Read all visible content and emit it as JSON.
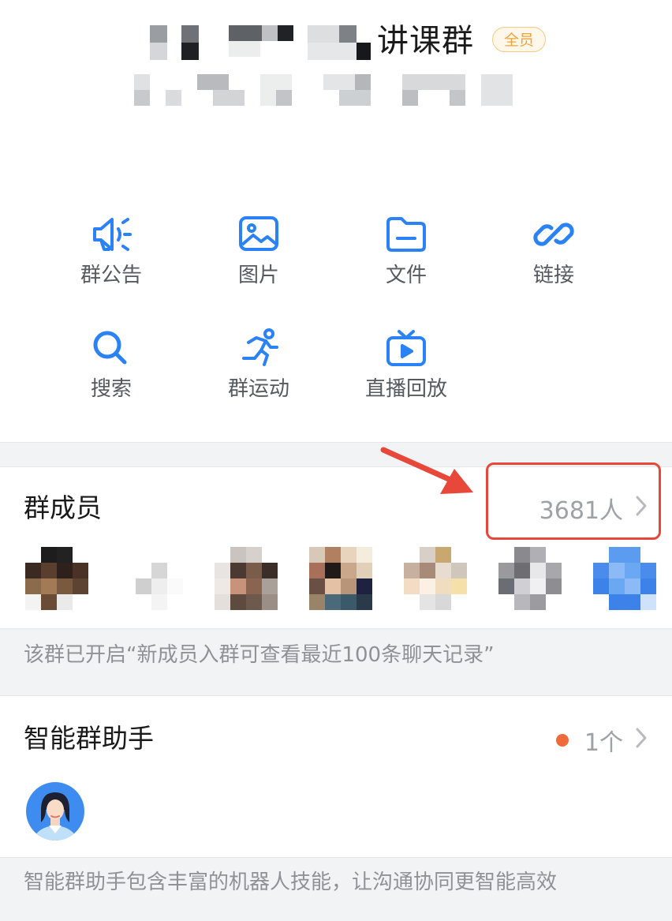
{
  "header": {
    "group_name_visible": "讲课群",
    "badge": "全员"
  },
  "features": [
    {
      "label": "群公告",
      "icon": "megaphone-icon"
    },
    {
      "label": "图片",
      "icon": "image-icon"
    },
    {
      "label": "文件",
      "icon": "folder-icon"
    },
    {
      "label": "链接",
      "icon": "link-icon"
    },
    {
      "label": "搜索",
      "icon": "search-icon"
    },
    {
      "label": "群运动",
      "icon": "running-icon"
    },
    {
      "label": "直播回放",
      "icon": "tv-play-icon"
    }
  ],
  "members": {
    "title": "群成员",
    "count": "3681人",
    "note": "该群已开启“新成员入群可查看最近100条聊天记录”"
  },
  "assistant": {
    "title": "智能群助手",
    "count": "1个",
    "note": "智能群助手包含丰富的机器人技能，让沟通协同更智能高效"
  },
  "colors": {
    "accent": "#2b82f6",
    "highlight": "#e8483a",
    "badge_text": "#f0a23a",
    "dot": "#f06a3c"
  }
}
